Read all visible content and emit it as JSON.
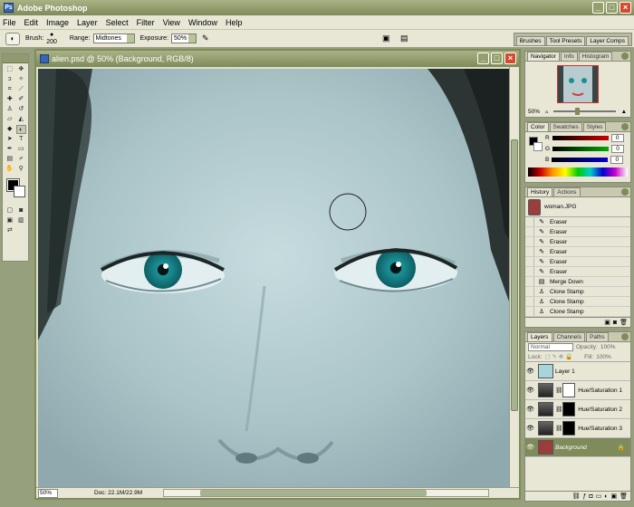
{
  "app": {
    "title": "Adobe Photoshop",
    "window_buttons": [
      "_",
      "□",
      "×"
    ]
  },
  "menu": [
    "File",
    "Edit",
    "Image",
    "Layer",
    "Select",
    "Filter",
    "View",
    "Window",
    "Help"
  ],
  "options": {
    "brush_label": "Brush:",
    "brush_size": "200",
    "range_label": "Range:",
    "range_value": "Midtones",
    "exposure_label": "Exposure:",
    "exposure_value": "50%",
    "well_tabs": [
      "Brushes",
      "Tool Presets",
      "Layer Comps"
    ]
  },
  "document": {
    "title": "alien.psd @ 50% (Background, RGB/8)",
    "zoom": "50%",
    "doc_size": "Doc: 22.1M/22.9M"
  },
  "navigator": {
    "tabs": [
      "Navigator",
      "Info",
      "Histogram"
    ],
    "zoom": "50%"
  },
  "color": {
    "tabs": [
      "Color",
      "Swatches",
      "Styles"
    ],
    "channels": [
      {
        "label": "R",
        "value": "0",
        "bar": "#c00"
      },
      {
        "label": "G",
        "value": "0",
        "bar": "#0a0"
      },
      {
        "label": "B",
        "value": "0",
        "bar": "#00c"
      }
    ]
  },
  "history": {
    "tabs": [
      "History",
      "Actions"
    ],
    "snapshot": "woman.JPG",
    "items": [
      "Eraser",
      "Eraser",
      "Eraser",
      "Eraser",
      "Eraser",
      "Eraser",
      "Merge Down",
      "Clone Stamp",
      "Clone Stamp",
      "Clone Stamp"
    ]
  },
  "layers": {
    "tabs": [
      "Layers",
      "Channels",
      "Paths"
    ],
    "blend_mode": "Normal",
    "opacity_label": "Opacity:",
    "opacity": "100%",
    "lock_label": "Lock:",
    "fill_label": "Fill:",
    "fill": "100%",
    "items": [
      {
        "name": "Layer 1",
        "thumb": "#a8d4dc",
        "mask": ""
      },
      {
        "name": "Hue/Saturation 1",
        "thumb": "#444",
        "mask": "#fff"
      },
      {
        "name": "Hue/Saturation 2",
        "thumb": "#444",
        "mask": "#000"
      },
      {
        "name": "Hue/Saturation 3",
        "thumb": "#444",
        "mask": "#000"
      },
      {
        "name": "Background",
        "thumb": "#9b3d3a",
        "mask": ""
      }
    ]
  },
  "colors": {
    "accent": "#7f8b5a",
    "workspace": "#97a07c",
    "panel": "#e8e7d6"
  }
}
